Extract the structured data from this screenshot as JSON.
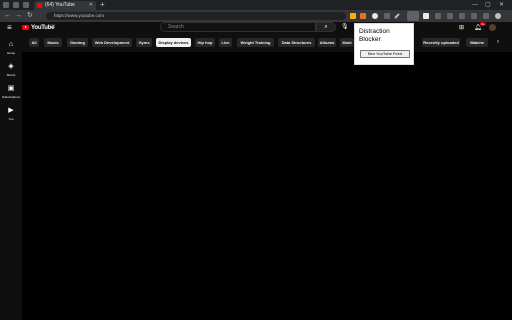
{
  "browser": {
    "tab_title": "(64) YouTube",
    "new_tab": "+",
    "url": "https://www.youtube.com",
    "window_controls": [
      "—",
      "▢",
      "✕"
    ]
  },
  "youtube": {
    "logo_text": "YouTube",
    "logo_country": "CA",
    "search_placeholder": "Search",
    "notification_count": "9+",
    "sidebar": [
      {
        "label": "Home",
        "icon": "home-icon",
        "glyph": "⌂"
      },
      {
        "label": "Shorts",
        "icon": "shorts-icon",
        "glyph": "◈"
      },
      {
        "label": "Subscriptions",
        "icon": "subscriptions-icon",
        "glyph": "▣"
      },
      {
        "label": "You",
        "icon": "you-icon",
        "glyph": "▶"
      }
    ],
    "chips": [
      {
        "label": "All",
        "active": false
      },
      {
        "label": "Music",
        "active": false
      },
      {
        "label": "Gaming",
        "active": false
      },
      {
        "label": "Web Development",
        "active": false
      },
      {
        "label": "Gyms",
        "active": false
      },
      {
        "label": "Display devices",
        "active": true
      },
      {
        "label": "Hip hop",
        "active": false
      },
      {
        "label": "Live",
        "active": false
      },
      {
        "label": "Weight Training",
        "active": false
      },
      {
        "label": "Data Structures",
        "active": false
      },
      {
        "label": "Albums",
        "active": false
      },
      {
        "label": "Mobi",
        "active": false
      },
      {
        "label": "Recently uploaded",
        "active": false
      },
      {
        "label": "Watche",
        "active": false
      }
    ]
  },
  "popup": {
    "title": "Distraction Blocker",
    "button_label": "Blur YouTube Feed"
  },
  "colors": {
    "brand_red": "#ff0000",
    "chrome_dark": "#202124",
    "chrome_toolbar": "#35363a"
  }
}
